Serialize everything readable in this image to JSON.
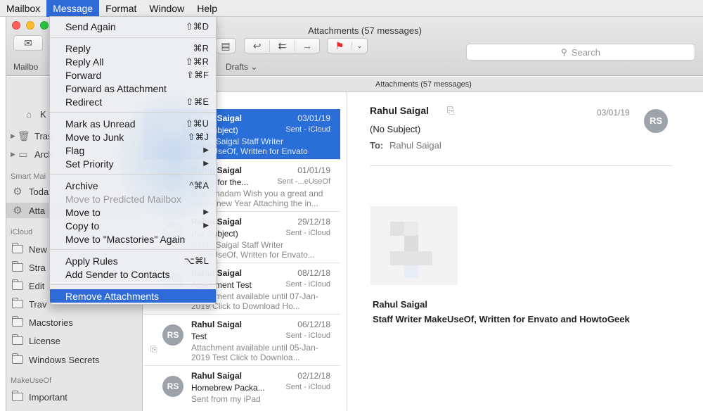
{
  "menubar": {
    "items": [
      "Mailbox",
      "Message",
      "Format",
      "Window",
      "Help"
    ],
    "active": "Message"
  },
  "window": {
    "title": "Attachments (57 messages)"
  },
  "toolbar": {
    "search_placeholder": "Search",
    "favorites": [
      "Mailbo",
      "Drafts ⌄"
    ]
  },
  "sidebar": {
    "items": [
      {
        "label": "K",
        "icon": "archive-icon"
      },
      {
        "label": "Tras",
        "icon": "trash-icon"
      },
      {
        "label": "Arch",
        "icon": "archive-icon"
      },
      {
        "label": "Toda",
        "icon": "gear-icon"
      },
      {
        "label": "Atta",
        "icon": "gear-icon"
      }
    ],
    "smart_header": "Smart Mai",
    "icloud_header": "iCloud",
    "icloud_folders": [
      "New",
      "Stra",
      "Edit",
      "Trav",
      "Macstories",
      "License",
      "Windows Secrets"
    ],
    "makeuseof_header": "MakeUseOf",
    "makeuseof_folders": [
      "Important"
    ]
  },
  "list": {
    "header": "Attachments (57 messages)",
    "messages": [
      {
        "from": "Rahul Saigal",
        "date": "03/01/19",
        "subject": "(No Subject)",
        "tag": "Sent - iCloud",
        "preview": "Rahul Saigal Staff Writer MakeUseOf, Written for Envato",
        "avatar": "RS"
      },
      {
        "from": "Rahul Saigal",
        "date": "01/01/19",
        "subject": "Notice for the...",
        "tag": "Sent -...eUseOf",
        "preview": "Hello madam Wish you a great and happy new Year Attaching the in...",
        "avatar": "RS"
      },
      {
        "from": "Rahul Saigal",
        "date": "29/12/18",
        "subject": "(No Subject)",
        "tag": "Sent - iCloud",
        "preview": "Rahul Saigal Staff Writer MakeUseOf, Written for Envato...",
        "avatar": "RS"
      },
      {
        "from": "Rahul Saigal",
        "date": "08/12/18",
        "subject": "Attachment Test",
        "tag": "Sent - iCloud",
        "preview": "Attachment available until 07-Jan-2019 Click to Download Ho...",
        "avatar": "RS"
      },
      {
        "from": "Rahul Saigal",
        "date": "06/12/18",
        "subject": "Test",
        "tag": "Sent - iCloud",
        "preview": "Attachment available until 05-Jan-2019 Test Click to Downloa...",
        "avatar": "RS"
      },
      {
        "from": "Rahul Saigal",
        "date": "02/12/18",
        "subject": "Homebrew Packa...",
        "tag": "Sent - iCloud",
        "preview": "Sent from my iPad",
        "avatar": "RS"
      }
    ]
  },
  "reader": {
    "from": "Rahul Saigal",
    "date": "03/01/19",
    "avatar": "RS",
    "subject": "(No Subject)",
    "to_label": "To:",
    "to": "Rahul Saigal",
    "signature_name": "Rahul Saigal",
    "signature_title": "Staff Writer MakeUseOf, Written for Envato and HowtoGeek"
  },
  "menu": {
    "items": [
      {
        "label": "Send Again",
        "shortcut": "⇧⌘D"
      },
      {
        "label": "Reply",
        "shortcut": "⌘R"
      },
      {
        "label": "Reply All",
        "shortcut": "⇧⌘R"
      },
      {
        "label": "Forward",
        "shortcut": "⇧⌘F"
      },
      {
        "label": "Forward as Attachment",
        "shortcut": ""
      },
      {
        "label": "Redirect",
        "shortcut": "⇧⌘E"
      },
      {
        "label": "Mark as Unread",
        "shortcut": "⇧⌘U"
      },
      {
        "label": "Move to Junk",
        "shortcut": "⇧⌘J"
      },
      {
        "label": "Flag",
        "shortcut": ""
      },
      {
        "label": "Set Priority",
        "shortcut": ""
      },
      {
        "label": "Archive",
        "shortcut": "^⌘A"
      },
      {
        "label": "Move to Predicted Mailbox",
        "shortcut": ""
      },
      {
        "label": "Move to",
        "shortcut": ""
      },
      {
        "label": "Copy to",
        "shortcut": ""
      },
      {
        "label": "Move to \"Macstories\" Again",
        "shortcut": ""
      },
      {
        "label": "Apply Rules",
        "shortcut": "⌥⌘L"
      },
      {
        "label": "Add Sender to Contacts",
        "shortcut": ""
      },
      {
        "label": "Remove Attachments",
        "shortcut": ""
      }
    ]
  },
  "colors": {
    "accent": "#2f6ad9",
    "selection": "#2a6ed8",
    "avatar": "#9ea3aa"
  }
}
